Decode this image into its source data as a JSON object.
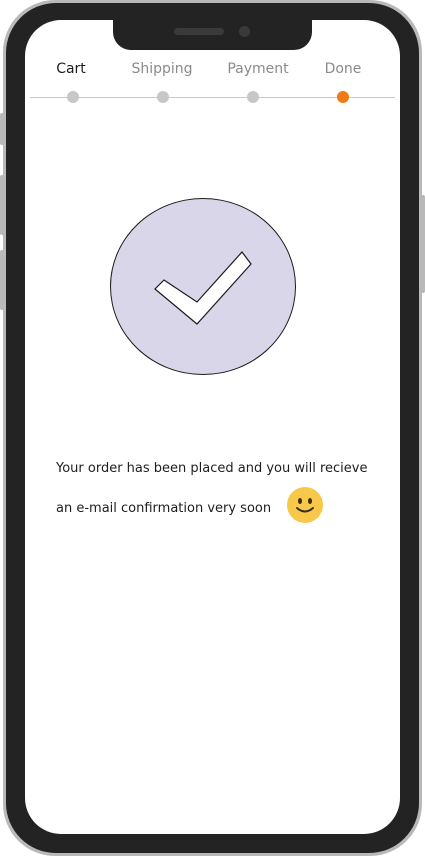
{
  "stepper": {
    "steps": [
      {
        "label": "Cart",
        "active": true
      },
      {
        "label": "Shipping",
        "active": false
      },
      {
        "label": "Payment",
        "active": false
      },
      {
        "label": "Done",
        "active": false
      }
    ],
    "current_step": "Done",
    "current_color": "#ef7a16",
    "inactive_color": "#c7c7c7"
  },
  "success": {
    "icon": "checkmark-icon",
    "circle_color": "#d9d6e9",
    "message_line1": "Your order has been placed and you will recieve",
    "message_line2": "an e-mail confirmation very soon",
    "emoji": "smiley-face-icon"
  }
}
